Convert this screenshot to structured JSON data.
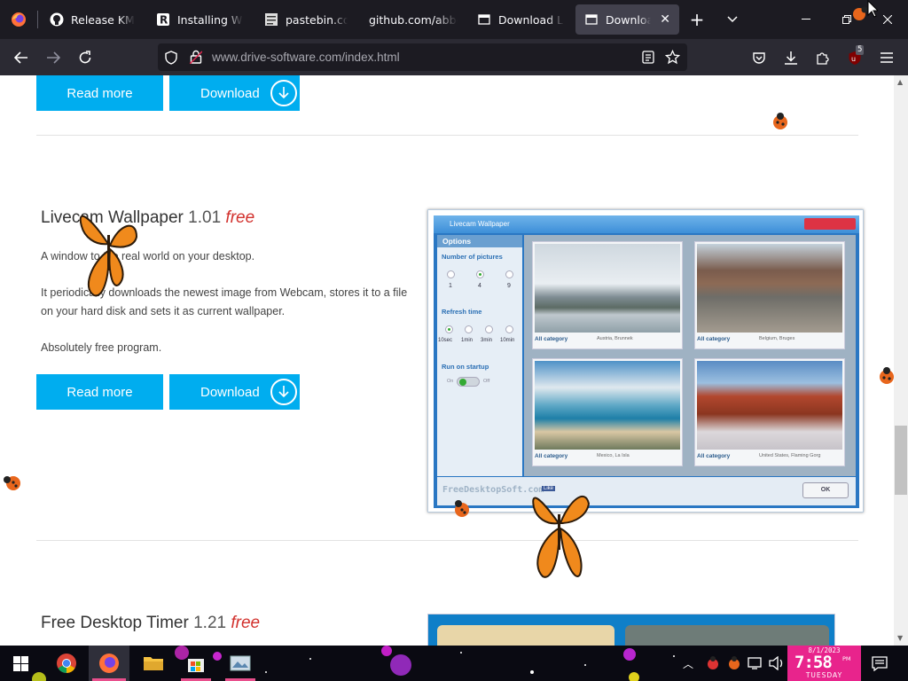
{
  "browser": {
    "tabs": [
      {
        "title": "Release KMSpico",
        "icon": "github-icon"
      },
      {
        "title": "Installing Windows",
        "icon": "r-icon"
      },
      {
        "title": "pastebin.com/",
        "icon": "pastebin-icon"
      },
      {
        "title": "github.com/abbodi",
        "icon": "none"
      },
      {
        "title": "Download Lad",
        "icon": "page-icon"
      },
      {
        "title": "Download Ani",
        "icon": "page-icon"
      }
    ],
    "url_domain": "www.drive-software.com",
    "url_path": "/index.html",
    "ublock_badge": "5"
  },
  "page": {
    "top_buttons": {
      "read_more": "Read more",
      "download": "Download"
    },
    "product": {
      "name": "Livecam Wallpaper",
      "version": "1.01",
      "price": "free",
      "desc1": "A window to the real world on your desktop.",
      "desc2": "It periodically downloads the newest image from Webcam, stores it to a file on your hard disk and sets it as current wallpaper.",
      "desc3": "Absolutely free program.",
      "read_more": "Read more",
      "download": "Download"
    },
    "screenshot": {
      "window_title": "Livecam Wallpaper",
      "options": "Options",
      "num_pictures": "Number of pictures",
      "pic_opts": [
        "1",
        "4",
        "9"
      ],
      "refresh_time": "Refresh time",
      "refresh_opts": [
        "10sec",
        "1min",
        "3min",
        "10min"
      ],
      "run_on_startup": "Run on startup",
      "toggle_on": "On",
      "toggle_off": "Off",
      "thumbs": [
        {
          "cat": "All category",
          "place": "Austria, Brunnek"
        },
        {
          "cat": "All category",
          "place": "Belgium, Bruges"
        },
        {
          "cat": "All category",
          "place": "Mexico, La Isla"
        },
        {
          "cat": "All category",
          "place": "United States, Flaming Gorg"
        }
      ],
      "brand": "FreeDesktopSoft.com",
      "like": "Like",
      "ok": "OK"
    },
    "next_product": {
      "name": "Free Desktop Timer",
      "version": "1.21",
      "price": "free"
    }
  },
  "taskbar": {
    "date": "8/1/2023",
    "time": "7:58",
    "ampm": "PM",
    "day": "TUESDAY"
  }
}
